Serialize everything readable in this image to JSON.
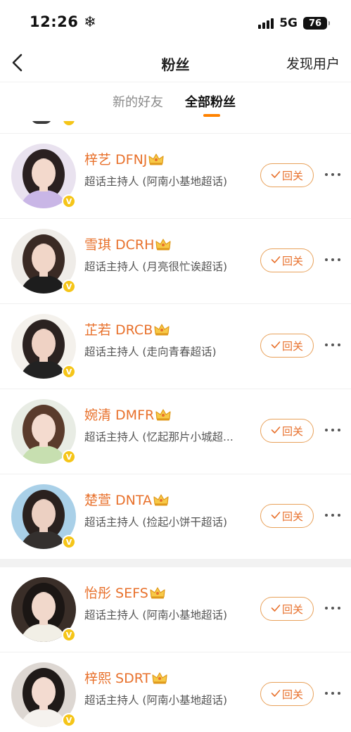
{
  "status_bar": {
    "time": "12:26 ❄",
    "network": "5G",
    "battery": "76"
  },
  "nav": {
    "title": "粉丝",
    "action": "发现用户"
  },
  "tabs": [
    {
      "label": "新的好友"
    },
    {
      "label": "全部粉丝",
      "selected": true
    }
  ],
  "accent_color": "#ff8200",
  "fans": [
    {
      "name": "梓艺 DFNJ",
      "desc": "超话主持人 (阿南小基地超话)",
      "button": "回关"
    },
    {
      "name": "雪琪 DCRH",
      "desc": "超话主持人 (月亮很忙诶超话)",
      "button": "回关"
    },
    {
      "name": "芷若 DRCB",
      "desc": "超话主持人 (走向青春超话)",
      "button": "回关"
    },
    {
      "name": "婉清 DMFR",
      "desc": "超话主持人 (忆起那片小城超...",
      "button": "回关"
    },
    {
      "name": "楚萱 DNTA",
      "desc": "超话主持人 (捡起小饼干超话)",
      "button": "回关"
    },
    {
      "name": "怡彤 SEFS",
      "desc": "超话主持人 (阿南小基地超话)",
      "button": "回关"
    },
    {
      "name": "梓熙 SDRT",
      "desc": "超话主持人 (阿南小基地超话)",
      "button": "回关"
    }
  ],
  "icons": {
    "back": "chevron-left-icon",
    "crown": "crown-icon",
    "verified": "verified-v-icon",
    "check": "check-icon",
    "more": "more-dots-icon"
  }
}
